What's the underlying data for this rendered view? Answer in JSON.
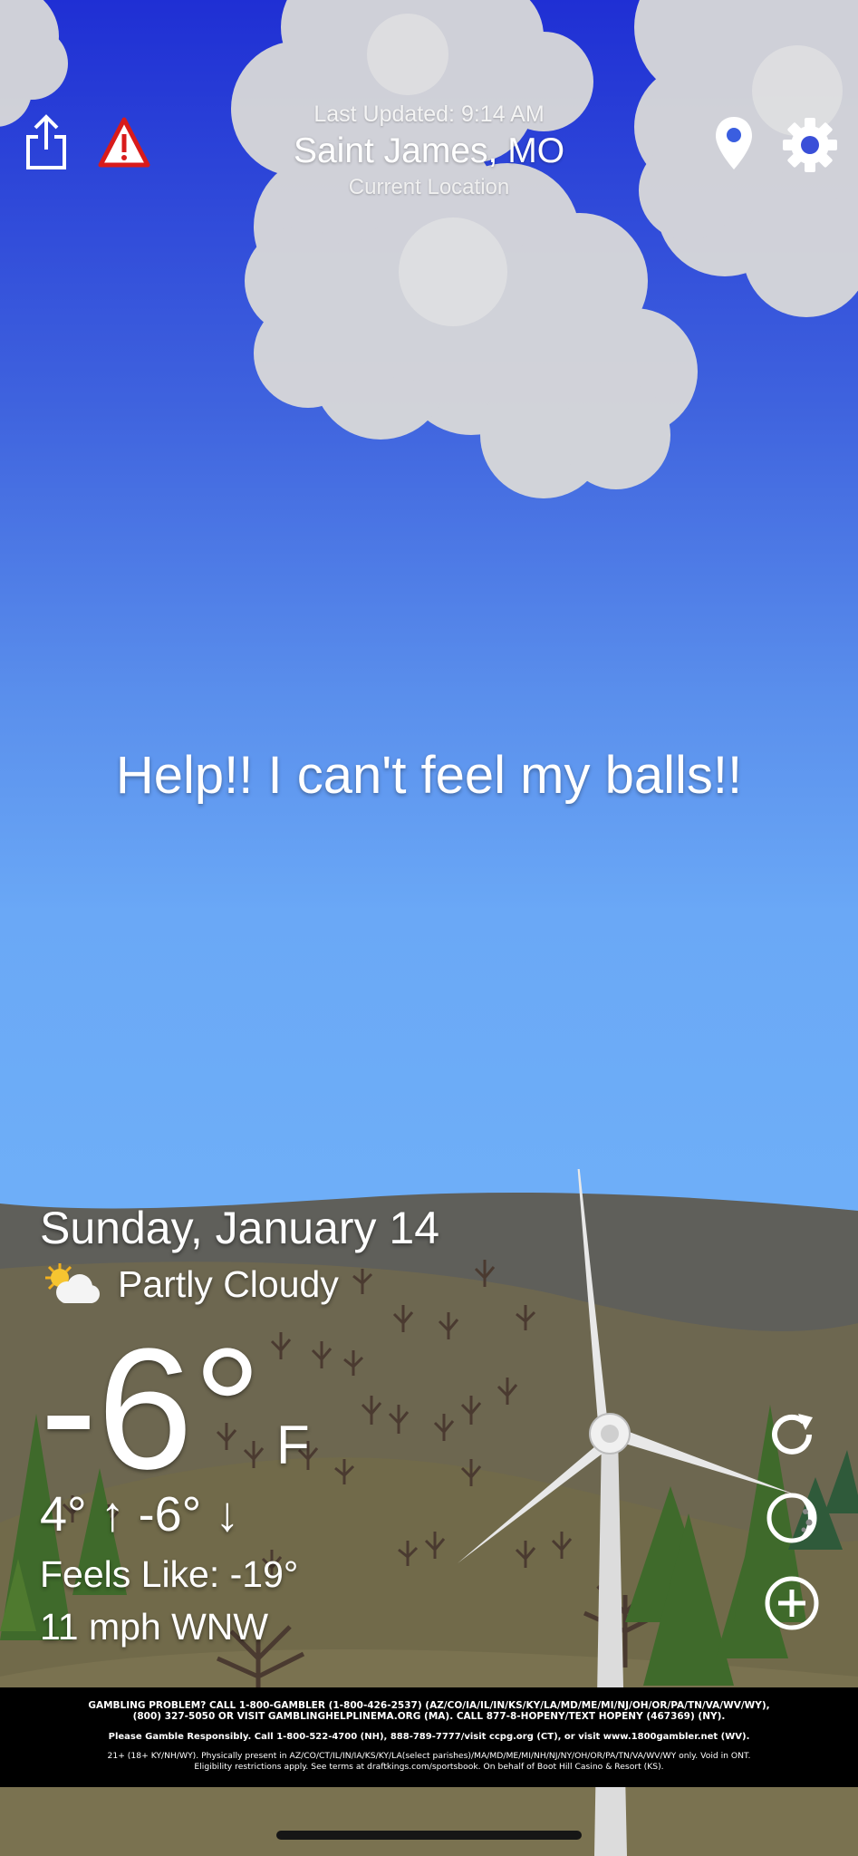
{
  "header": {
    "last_updated": "Last Updated: 9:14 AM",
    "city": "Saint James, MO",
    "subtitle": "Current Location"
  },
  "toolbar": {
    "left": [
      {
        "name": "share-icon"
      },
      {
        "name": "alert-triangle-icon"
      }
    ],
    "right": [
      {
        "name": "location-pin-icon"
      },
      {
        "name": "settings-gear-icon"
      }
    ]
  },
  "message": "Help!! I can't feel my balls!!",
  "weather": {
    "date": "Sunday, January 14",
    "condition": "Partly Cloudy",
    "condition_icon": "partly-cloudy-icon",
    "temperature": "-6°",
    "unit": "F",
    "hi_lo": "4° ↑  -6° ↓",
    "feels_like": "Feels Like: -19°",
    "wind": "11 mph WNW"
  },
  "actions": [
    {
      "name": "refresh-icon"
    },
    {
      "name": "moon-phase-icon"
    },
    {
      "name": "add-location-icon"
    }
  ],
  "ad": {
    "line1a": "GAMBLING PROBLEM? CALL 1-800-GAMBLER (1-800-426-2537) (AZ/CO/IA/IL/IN/KS/KY/LA/MD/ME/MI/NJ/OH/OR/PA/TN/VA/WV/WY),",
    "line1b": "(800) 327-5050 OR VISIT GAMBLINGHELPLINEMA.ORG (MA). CALL 877-8-HOPENY/TEXT HOPENY (467369) (NY).",
    "line2": "Please Gamble Responsibly. Call 1-800-522-4700 (NH), 888-789-7777/visit ccpg.org (CT), or visit www.1800gambler.net (WV).",
    "line3a": "21+ (18+ KY/NH/WY). Physically present in AZ/CO/CT/IL/IN/IA/KS/KY/LA(select parishes)/MA/MD/ME/MI/NH/NJ/NY/OH/OR/PA/TN/VA/WV/WY only. Void in ONT.",
    "line3b": "Eligibility restrictions apply. See terms at draftkings.com/sportsbook. On behalf of Boot Hill Casino & Resort (KS)."
  },
  "colors": {
    "sky_top": "#1f2fd4",
    "sky_bottom": "#6fb0f8",
    "hill_far": "#5f5f5a",
    "hill_near": "#6f6548",
    "tree_green": "#3f6a2b",
    "alert_red": "#d81b1b"
  }
}
